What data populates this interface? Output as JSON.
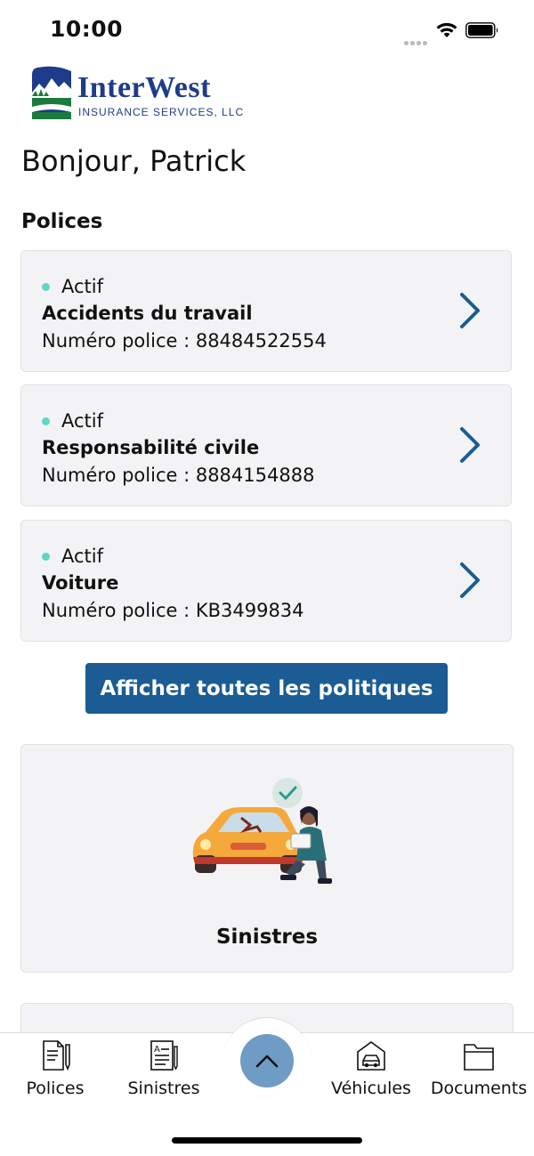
{
  "status_bar": {
    "time": "10:00"
  },
  "logo": {
    "title": "InterWest",
    "subtitle": "INSURANCE SERVICES, LLC"
  },
  "greeting": "Bonjour, Patrick",
  "policies_section": {
    "title": "Polices",
    "items": [
      {
        "status": "Actif",
        "name": "Accidents du travail",
        "number": "Numéro police : 88484522554"
      },
      {
        "status": "Actif",
        "name": "Responsabilité civile",
        "number": "Numéro police : 8884154888"
      },
      {
        "status": "Actif",
        "name": "Voiture",
        "number": "Numéro police : KB3499834"
      }
    ],
    "show_all_label": "Afficher toutes les politiques"
  },
  "claims_card": {
    "label": "Sinistres",
    "illustration": "car-inspection-illustration"
  },
  "bottom_nav": {
    "items": [
      {
        "label": "Polices",
        "icon": "policy-document-icon"
      },
      {
        "label": "Sinistres",
        "icon": "claims-form-icon"
      },
      {
        "label": "Véhicules",
        "icon": "vehicle-garage-icon"
      },
      {
        "label": "Documents",
        "icon": "folder-icon"
      }
    ],
    "fab_icon": "chevron-up-icon"
  },
  "colors": {
    "primary": "#1a5c93",
    "active_status": "#5fd6c3",
    "card_bg": "#f3f3f5",
    "fab": "#6e9cc4",
    "logo": "#1f3c8a"
  }
}
